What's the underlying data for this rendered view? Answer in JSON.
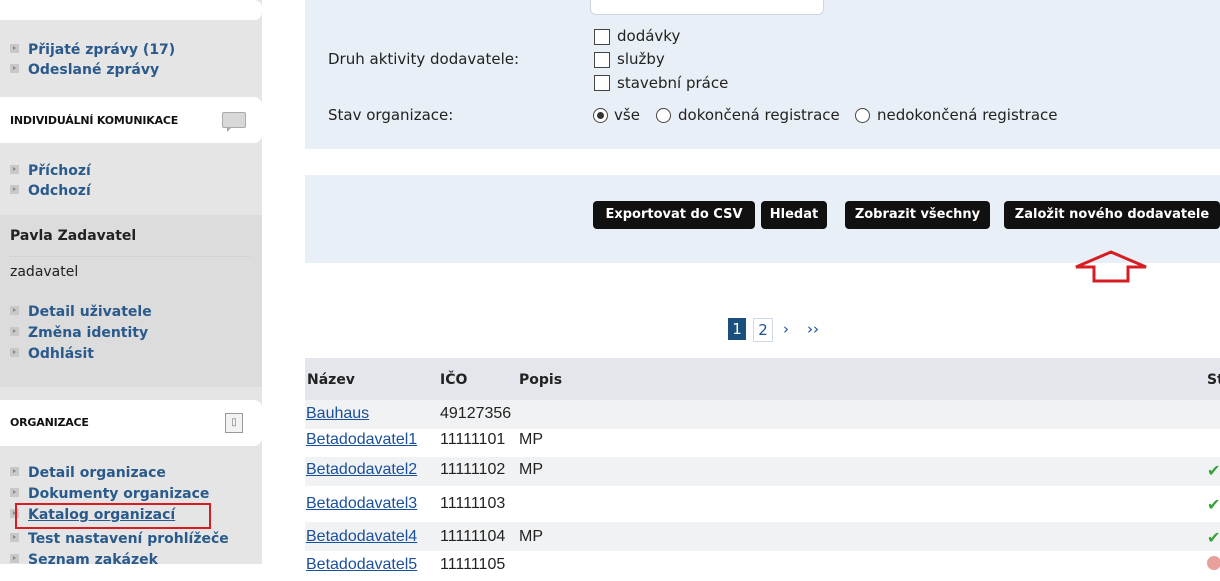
{
  "sidebar": {
    "messages": [
      {
        "label": "Přijaté zprávy (17)"
      },
      {
        "label": "Odeslané zprávy"
      }
    ],
    "individual_section": {
      "title": "INDIVIDUÁLNÍ KOMUNIKACE"
    },
    "individual_links": [
      {
        "label": "Příchozí"
      },
      {
        "label": "Odchozí"
      }
    ],
    "user": {
      "name": "Pavla Zadavatel",
      "role": "zadavatel"
    },
    "user_links": [
      {
        "label": "Detail uživatele"
      },
      {
        "label": "Změna identity"
      },
      {
        "label": "Odhlásit"
      }
    ],
    "org_section": {
      "title": "ORGANIZACE"
    },
    "org_links": [
      {
        "label": "Detail organizace"
      },
      {
        "label": "Dokumenty organizace"
      },
      {
        "label": "Katalog organizací"
      },
      {
        "label": "Test nastavení prohlížeče"
      },
      {
        "label": "Seznam zakázek"
      }
    ]
  },
  "filters": {
    "activity_label": "Druh aktivity dodavatele:",
    "activity_options": [
      {
        "label": "dodávky",
        "checked": false
      },
      {
        "label": "služby",
        "checked": false
      },
      {
        "label": "stavební práce",
        "checked": false
      }
    ],
    "state_label": "Stav organizace:",
    "state_options": [
      {
        "label": "vše",
        "selected": true
      },
      {
        "label": "dokončená registrace",
        "selected": false
      },
      {
        "label": "nedokončená registrace",
        "selected": false
      }
    ]
  },
  "actions": {
    "export_csv": "Exportovat do CSV",
    "search": "Hledat",
    "show_all": "Zobrazit všechny",
    "new_supplier": "Založit nového dodavatele"
  },
  "pagination": {
    "current": "1",
    "next_page": "2",
    "next": "›",
    "last": "››"
  },
  "table": {
    "headers": {
      "name": "Název",
      "ico": "IČO",
      "description": "Popis",
      "status": "St"
    },
    "rows": [
      {
        "name": "Bauhaus",
        "ico": "49127356",
        "description": "",
        "status_ok": false
      },
      {
        "name": "Betadodavatel1",
        "ico": "11111101",
        "description": "MP",
        "status_ok": false
      },
      {
        "name": "Betadodavatel2",
        "ico": "11111102",
        "description": "MP",
        "status_ok": true
      },
      {
        "name": "Betadodavatel3",
        "ico": "11111103",
        "description": "",
        "status_ok": true
      },
      {
        "name": "Betadodavatel4",
        "ico": "11111104",
        "description": "MP",
        "status_ok": true
      },
      {
        "name": "Betadodavatel5",
        "ico": "11111105",
        "description": "",
        "status_ok": false
      }
    ],
    "status_icon": "✔"
  },
  "colors": {
    "sidebar_bg": "#e5e5e5",
    "panel_bg": "#e9eff6",
    "link": "#1a4f9c",
    "highlight_red": "#d71d24",
    "status_ok": "#3aa13a"
  },
  "icons": {
    "chat": "chat-bubble-icon",
    "org": "document-icon",
    "arrow": "up-arrow-annotation"
  }
}
